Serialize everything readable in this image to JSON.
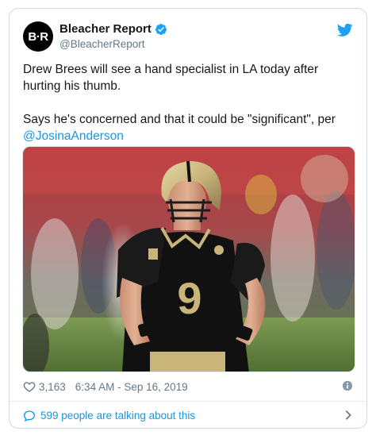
{
  "account": {
    "avatar_text": "B·R",
    "display_name": "Bleacher Report",
    "handle": "@BleacherReport"
  },
  "tweet": {
    "line1": "Drew Brees will see a hand specialist in LA today after hurting his thumb.",
    "line2": "Says he's concerned and that it could be \"significant\", per",
    "mention": "@JosinaAnderson"
  },
  "media": {
    "description": "Photo of an NFL quarterback in a black Saints jersey number 9 with a gold helmet"
  },
  "meta": {
    "likes": "3,163",
    "timestamp": "6:34 AM - Sep 16, 2019"
  },
  "footer": {
    "talking": "599 people are talking about this"
  },
  "colors": {
    "link": "#1b95e0",
    "text": "#14171a",
    "muted": "#657786",
    "border": "#cfd9de"
  }
}
